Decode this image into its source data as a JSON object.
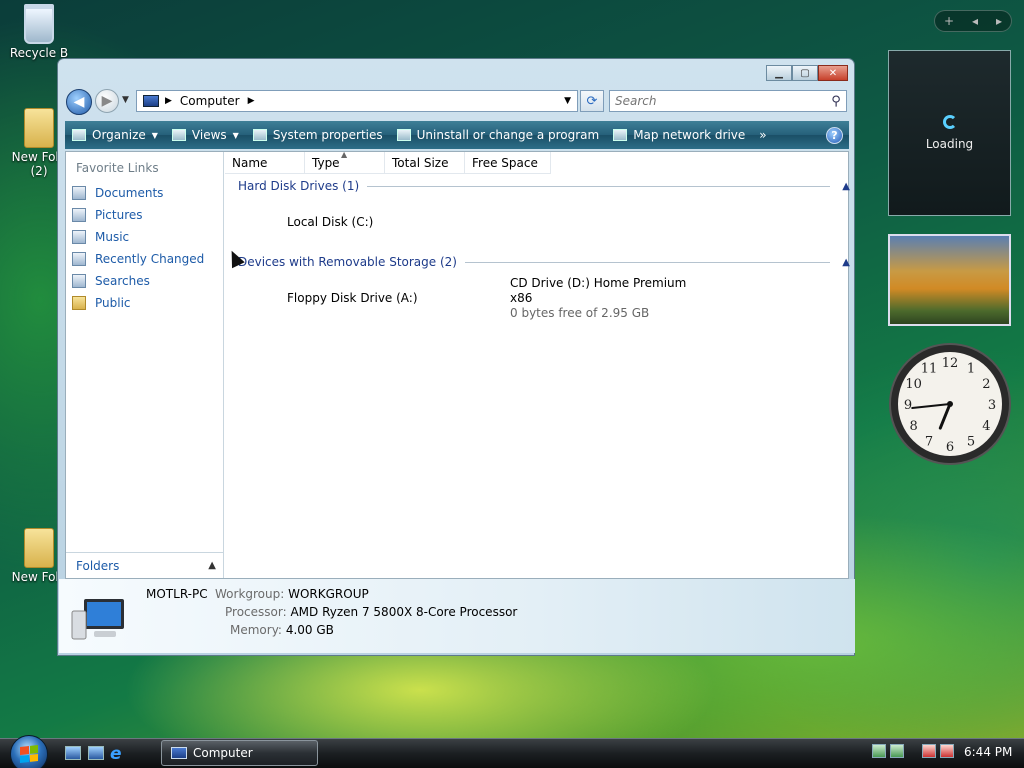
{
  "desktop": {
    "icons": [
      {
        "label": "Recycle B"
      },
      {
        "label": "New Fold\n(2)"
      },
      {
        "label": "New Fold"
      }
    ]
  },
  "sidebar": {
    "controls": [
      "+",
      "◂",
      "▸"
    ],
    "feed_status": "Loading",
    "clock": {
      "hour": 6,
      "minute": 44,
      "numerals": [
        "12",
        "1",
        "2",
        "3",
        "4",
        "5",
        "6",
        "7",
        "8",
        "9",
        "10",
        "11"
      ]
    }
  },
  "window": {
    "caption_buttons": [
      "minimize",
      "maximize",
      "close"
    ],
    "address": {
      "location": "Computer"
    },
    "search": {
      "placeholder": "Search"
    },
    "toolbar": [
      {
        "label": "Organize",
        "icon": "organize-icon",
        "has_menu": true
      },
      {
        "label": "Views",
        "icon": "views-icon",
        "has_menu": true
      },
      {
        "label": "System properties",
        "icon": "system-properties-icon"
      },
      {
        "label": "Uninstall or change a program",
        "icon": "uninstall-icon"
      },
      {
        "label": "Map network drive",
        "icon": "map-network-drive-icon"
      },
      {
        "label": "»",
        "icon": "more-chevron-icon"
      }
    ],
    "favorites": {
      "title": "Favorite Links",
      "items": [
        {
          "label": "Documents",
          "icon": "documents-icon"
        },
        {
          "label": "Pictures",
          "icon": "pictures-icon"
        },
        {
          "label": "Music",
          "icon": "music-icon"
        },
        {
          "label": "Recently Changed",
          "icon": "recently-changed-icon"
        },
        {
          "label": "Searches",
          "icon": "searches-icon"
        },
        {
          "label": "Public",
          "icon": "folder-icon"
        }
      ],
      "folders_label": "Folders"
    },
    "columns": [
      "Name",
      "Type",
      "Total Size",
      "Free Space"
    ],
    "groups": [
      {
        "title": "Hard Disk Drives (1)",
        "items": [
          {
            "name": "Local Disk (C:)"
          }
        ]
      },
      {
        "title": "Devices with Removable Storage (2)",
        "items": [
          {
            "name": "Floppy Disk Drive (A:)"
          },
          {
            "name": "CD Drive (D:) Home Premium",
            "name2": "x86",
            "detail": "0 bytes free of 2.95 GB"
          }
        ]
      }
    ],
    "details": {
      "computer_name": "MOTLR-PC",
      "workgroup_label": "Workgroup:",
      "workgroup": "WORKGROUP",
      "processor_label": "Processor:",
      "processor": "AMD Ryzen 7 5800X 8-Core Processor",
      "memory_label": "Memory:",
      "memory": "4.00 GB"
    }
  },
  "taskbar": {
    "task_label": "Computer",
    "time": "6:44 PM"
  }
}
